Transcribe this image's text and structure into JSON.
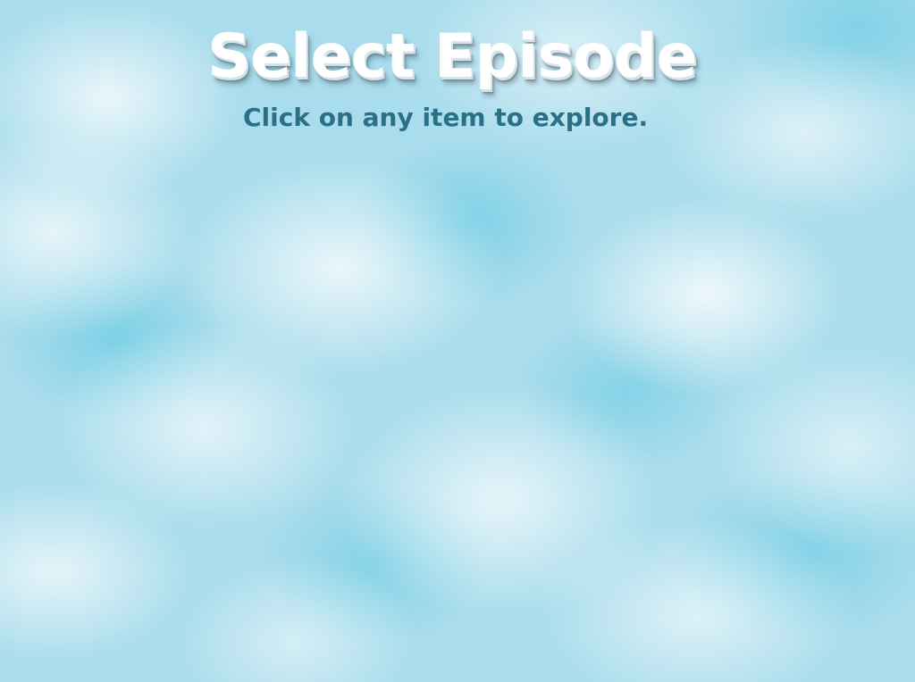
{
  "screen": {
    "title": "Select Episode",
    "subtitle": "Click on any item to explore."
  },
  "colors": {
    "sky": "#a9dcec",
    "title_text": "#ffffff",
    "subtitle_text": "#2a7088"
  }
}
